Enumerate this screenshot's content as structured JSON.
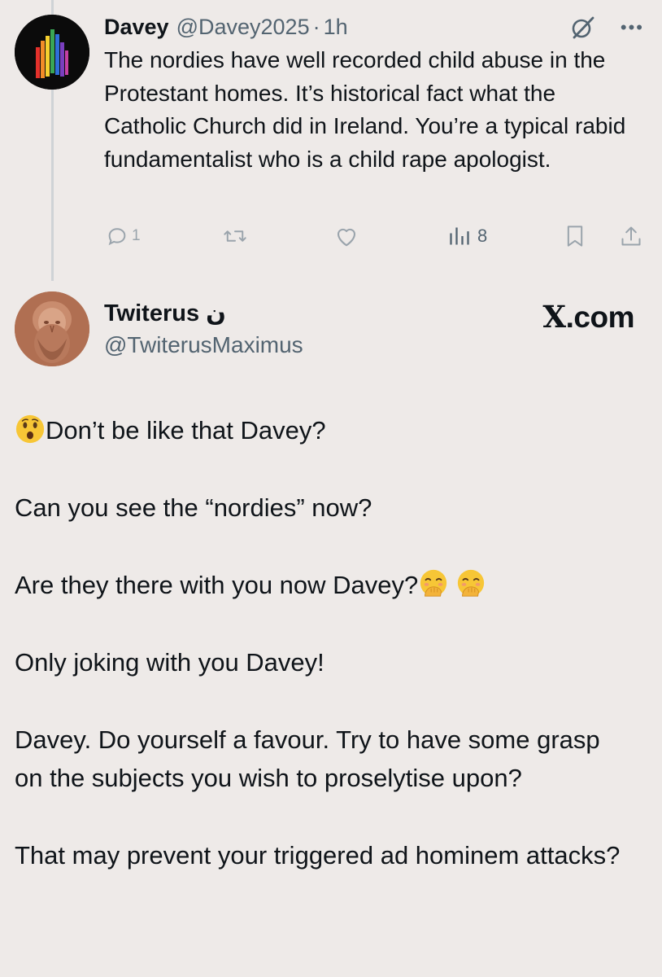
{
  "post1": {
    "author_name": "Davey",
    "author_handle": "@Davey2025",
    "separator": "·",
    "time": "1h",
    "text": "The nordies have well recorded child abuse in the Protestant homes. It’s historical fact what the Catholic Church did in Ireland. You’re a typical rabid fundamentalist who is a child rape apologist.",
    "icons": {
      "grok": "grok-slash-icon",
      "more": "more-dots-icon",
      "reply": "reply-bubble-icon",
      "repost": "repost-arrows-icon",
      "like": "heart-icon",
      "views": "views-bars-icon",
      "bookmark": "bookmark-icon",
      "share": "share-upload-icon"
    },
    "stats": {
      "replies": "1",
      "views": "8"
    }
  },
  "post2": {
    "author_name": "Twiterus ن",
    "author_handle": "@TwiterusMaximus",
    "brand": "X.com",
    "paragraphs": [
      "Don’t be like that Davey?",
      "Can you see the “nordies” now?",
      "Are they there with you now Davey?",
      "Only joking with you Davey!",
      "Davey. Do yourself a favour. Try to have some grasp on the subjects you wish to proselytise upon?",
      "That may prevent your triggered ad hominem attacks?"
    ],
    "emojis": {
      "p1": "astonished-face-emoji",
      "p3": "face-with-hand-over-mouth-emoji"
    }
  },
  "colors": {
    "background": "#eeeae8",
    "text": "#0f1419",
    "secondary_text": "#536471",
    "thread_line": "#cfd3d6",
    "icon_muted": "#9aa4ac"
  }
}
